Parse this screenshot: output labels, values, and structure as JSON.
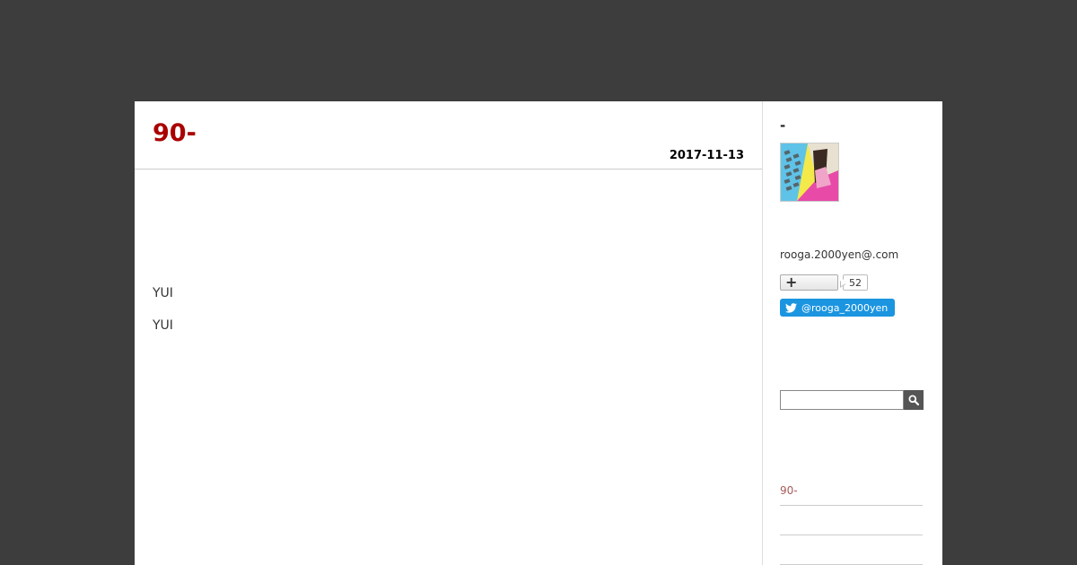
{
  "entry": {
    "title": "90-",
    "date": "2017-11-13",
    "paragraphs": [
      "YUI",
      "YUI"
    ]
  },
  "sidebar": {
    "profile_name": "-",
    "email": "rooga.2000yen@.com",
    "follow_count": "52",
    "twitter_handle": "@rooga_2000yen",
    "search_placeholder": "",
    "recent_entries": [
      {
        "label": "90-"
      },
      {
        "label": ""
      },
      {
        "label": ""
      }
    ]
  },
  "colors": {
    "background": "#3d3d3d",
    "title": "#aa0000",
    "twitter": "#1b95e0",
    "link": "#aa5a5a"
  },
  "icons": {
    "follow": "plus-icon",
    "twitter": "twitter-bird-icon",
    "search": "magnifier-icon"
  }
}
